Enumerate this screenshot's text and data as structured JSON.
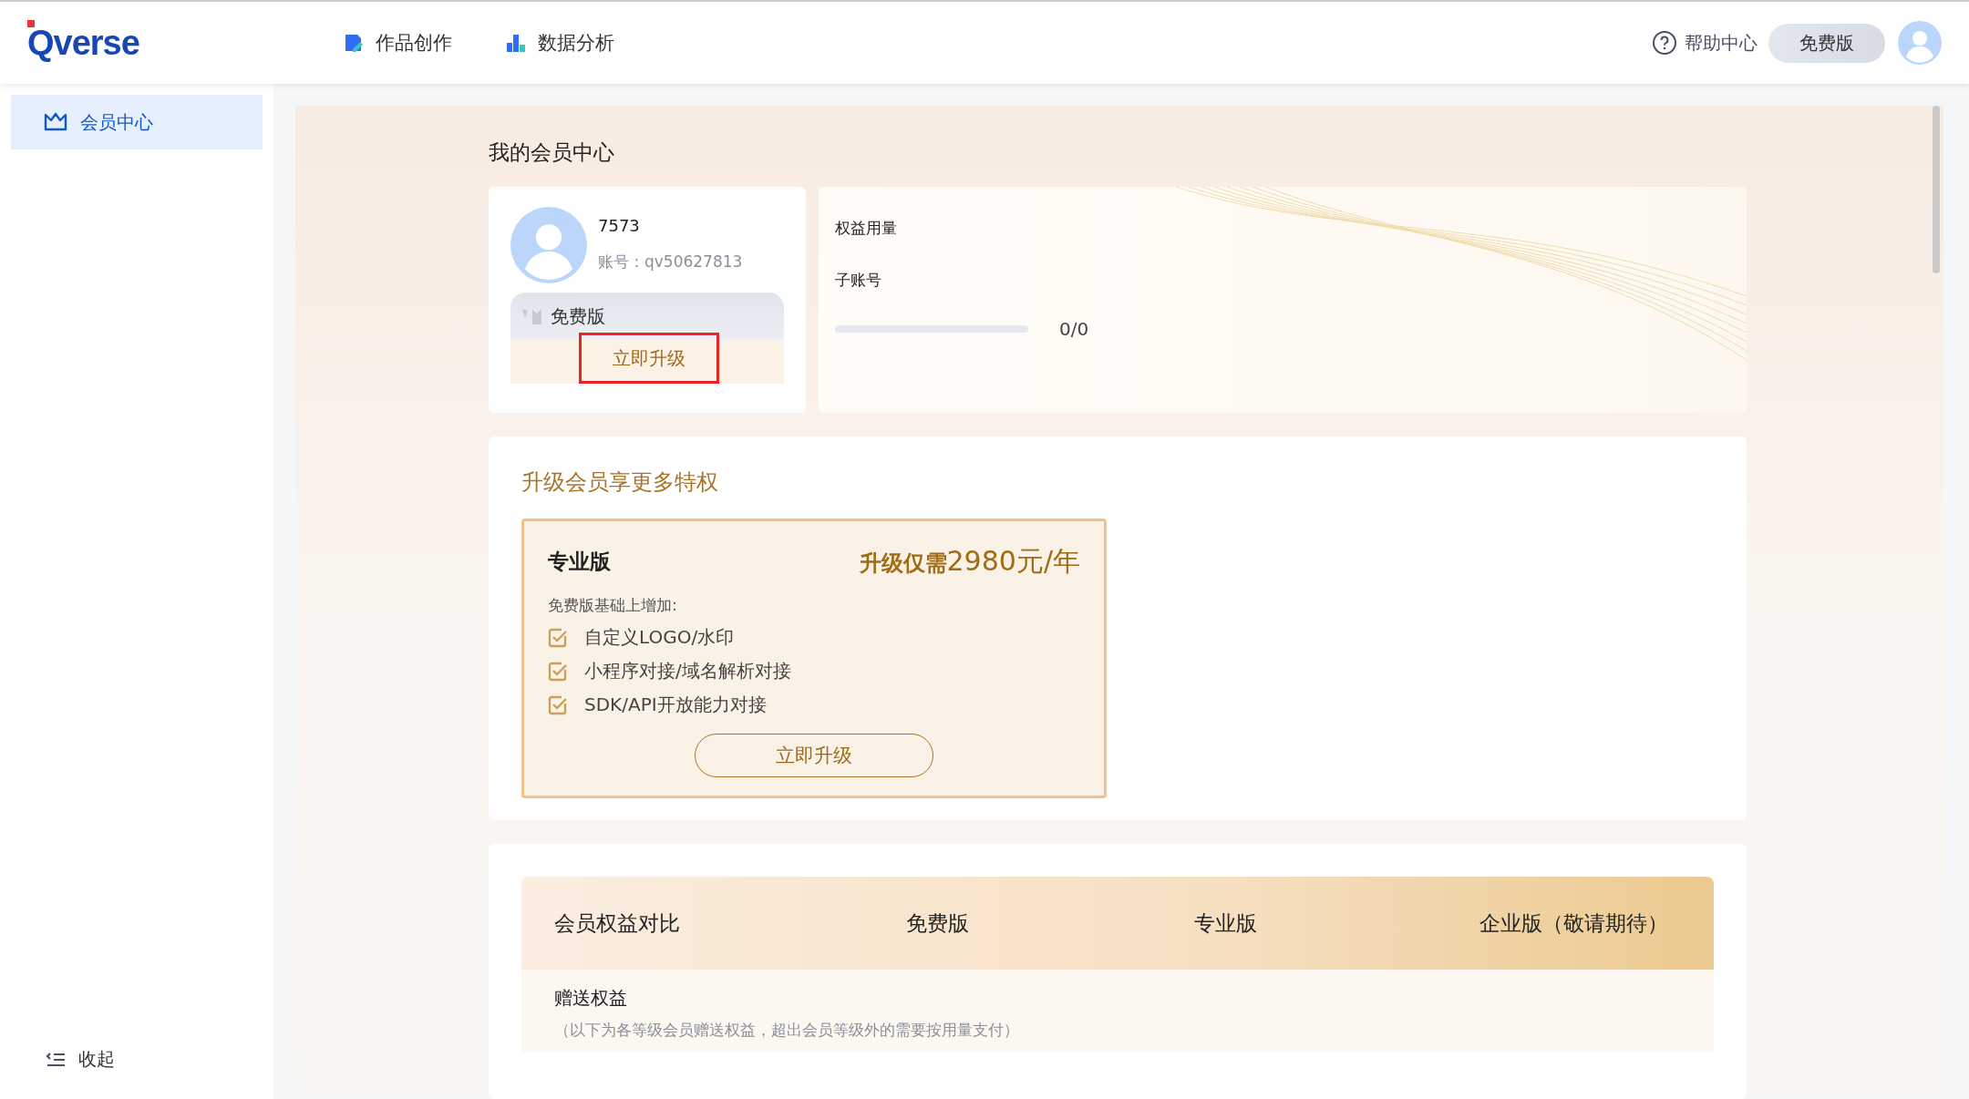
{
  "header": {
    "logo": "Qverse",
    "nav": [
      {
        "label": "作品创作"
      },
      {
        "label": "数据分析"
      }
    ],
    "help": "帮助中心",
    "plan_badge": "免费版"
  },
  "sidebar": {
    "items": [
      {
        "label": "会员中心",
        "selected": true
      }
    ],
    "collapse": "收起"
  },
  "page_title": "我的会员中心",
  "profile": {
    "name": "7573",
    "account": "账号：qv50627813",
    "plan": "免费版",
    "upgrade_button": {
      "label": "立即升级",
      "highlighted": true
    }
  },
  "usage": {
    "title": "权益用量",
    "label": "子账号",
    "level": 0,
    "reading": "0/0"
  },
  "upgrade_section": {
    "title": "升级会员享更多特权",
    "card": {
      "name": "专业版",
      "price_prefix": "升级仅需",
      "price": "2980元/年",
      "intro": "免费版基础上增加:",
      "features": [
        {
          "label": "自定义LOGO/水印",
          "checked": true
        },
        {
          "label": "小程序对接/域名解析对接",
          "checked": true
        },
        {
          "label": "SDK/API开放能力对接",
          "checked": true
        }
      ],
      "button": "立即升级"
    }
  },
  "comparison": {
    "columns": [
      "会员权益对比",
      "免费版",
      "专业版",
      "企业版（敬请期待）"
    ],
    "group": {
      "title": "赠送权益",
      "note": "（以下为各等级会员赠送权益，超出会员等级外的需要按用量支付）"
    }
  }
}
